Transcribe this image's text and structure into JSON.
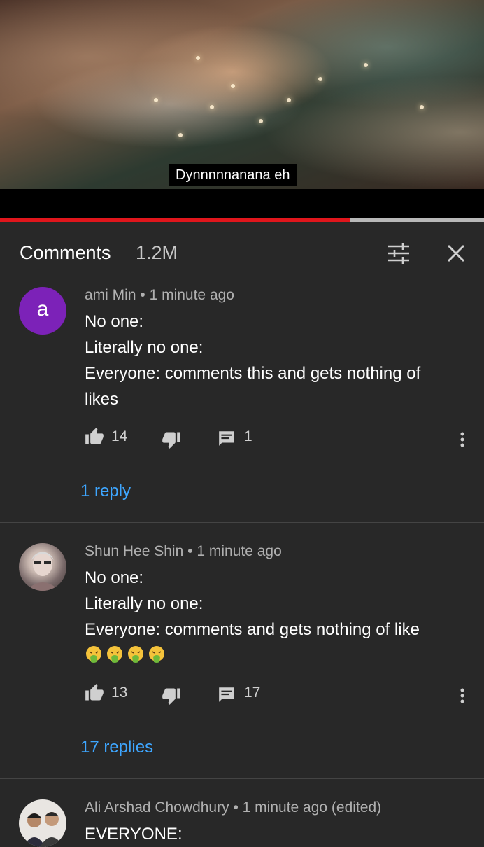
{
  "video": {
    "subtitle": "Dynnnnnanana eh",
    "progress_fraction": 0.722
  },
  "header": {
    "title": "Comments",
    "count": "1.2M",
    "icons": [
      "filter-sliders-icon",
      "close-icon"
    ]
  },
  "comments": [
    {
      "author": "ami Min",
      "separator": "•",
      "time": "1 minute ago",
      "avatar_letter": "a",
      "avatar_color": "#7c22b8",
      "lines": [
        "No one:",
        "Literally no one:",
        "Everyone: comments this and gets nothing of",
        "likes"
      ],
      "likes": "14",
      "reply_count_badge": "1",
      "replies_label": "1 reply"
    },
    {
      "author": "Shun Hee Shin",
      "separator": "•",
      "time": "1 minute ago",
      "lines": [
        "No one:",
        "Literally no one:",
        "Everyone: comments and gets nothing of like"
      ],
      "emoji_line": "🤮🤮🤮🤮",
      "likes": "13",
      "reply_count_badge": "17",
      "replies_label": "17 replies"
    },
    {
      "author": "Ali Arshad Chowdhury",
      "separator": "•",
      "time": "1 minute ago (edited)",
      "lines": [
        "EVERYONE:"
      ]
    }
  ],
  "colors": {
    "background": "#282828",
    "accent_link": "#3ea6ff",
    "progress_red": "#e0161c"
  }
}
